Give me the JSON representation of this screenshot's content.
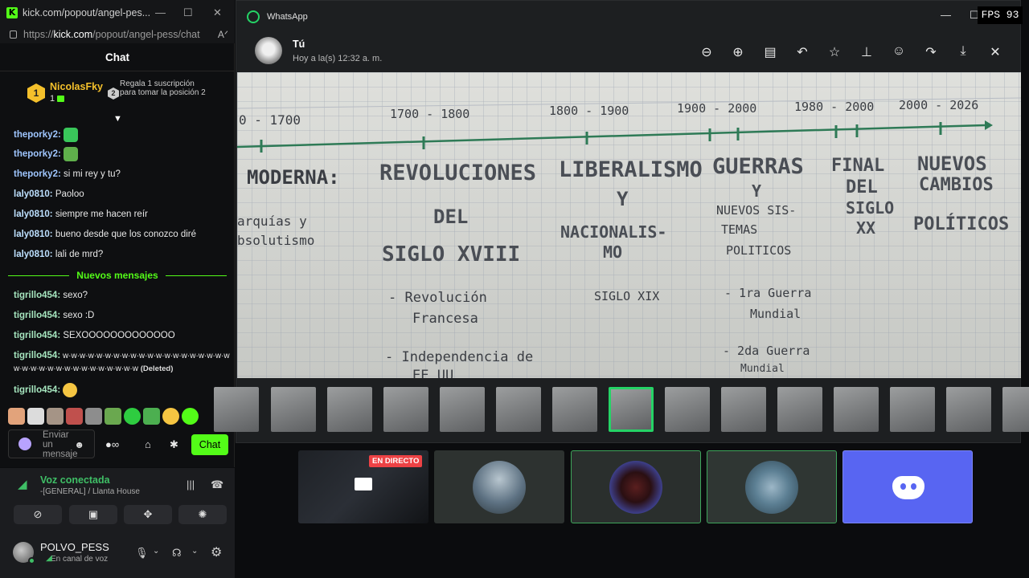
{
  "kick": {
    "tab_title": "kick.com/popout/angel-pes...",
    "url_prefix": "https://",
    "url_domain": "kick.com",
    "url_path": "/popout/angel-pess/chat",
    "chat_title": "Chat",
    "pinned": {
      "rank1_number": "1",
      "rank1_user": "NicolasFky",
      "rank1_count": "1",
      "rank2_number": "2",
      "rank2_text": "Regala 1 suscripción para tomar la posición 2"
    },
    "messages": [
      {
        "user": "theporky2",
        "text": ""
      },
      {
        "user": "theporky2",
        "text": ""
      },
      {
        "user": "theporky2",
        "text": "si mi rey y tu?"
      },
      {
        "user": "laly0810",
        "text": "Paoloo"
      },
      {
        "user": "laly0810",
        "text": "siempre me hacen reír"
      },
      {
        "user": "laly0810",
        "text": "bueno desde que los conozco diré"
      },
      {
        "user": "laly0810",
        "text": "lali de mrd?"
      }
    ],
    "new_messages_label": "Nuevos mensajes",
    "new_messages": [
      {
        "user": "tigrillo454",
        "text": "sexo?"
      },
      {
        "user": "tigrillo454",
        "text": "sexo :D"
      },
      {
        "user": "tigrillo454",
        "text": "SEXOOOOOOOOOOOOO"
      },
      {
        "user": "tigrillo454",
        "text": "w·w·w·w·w·w·w·w·w·w·w·w·w·w·w·w·w·w·w·w",
        "text2": "w·w·w·w·w·w·w·w·w·w·w·w·w·w·w",
        "deleted": "(Deleted)"
      },
      {
        "user": "tigrillo454",
        "text": ""
      }
    ],
    "input_placeholder": "Enviar un mensaje",
    "send_label": "Chat"
  },
  "discord": {
    "voice_title": "Voz conectada",
    "voice_channel": "-[GENERAL] / Llanta House",
    "username": "POLVO_PESS",
    "user_status": "En canal de voz"
  },
  "whatsapp": {
    "app_title": "WhatsApp",
    "sender": "Tú",
    "timestamp": "Hoy a la(s) 12:32 a. m.",
    "notebook": {
      "dates": [
        "0 - 1700",
        "1700 - 1800",
        "1800 - 1900",
        "1900 - 2000",
        "1980 - 2000",
        "2000 - 2026"
      ],
      "col1": [
        "MODERNA:",
        "arquías y",
        "bsolutismo"
      ],
      "col2": [
        "REVOLUCIONES",
        "DEL",
        "SIGLO XVIII",
        "- Revolución",
        "Francesa",
        "- Independencia de",
        "EE UU"
      ],
      "col3": [
        "LIBERALISMO",
        "Y",
        "NACIONALIS-",
        "MO",
        "SIGLO XIX"
      ],
      "col4": [
        "GUERRAS",
        "Y",
        "NUEVOS SIS-",
        "TEMAS",
        "POLITICOS",
        "- 1ra Guerra",
        "Mundial",
        "- 2da Guerra",
        "Mundial"
      ],
      "col5": [
        "FINAL",
        "DEL",
        "SIGLO",
        "XX"
      ],
      "col6": [
        "NUEVOS",
        "CAMBIOS",
        "POLÍTICOS"
      ]
    }
  },
  "overlay": {
    "fps": "FPS 93",
    "live_badge": "EN DIRECTO"
  },
  "colors": {
    "kick_green": "#53fc18",
    "whatsapp_green": "#25d366",
    "discord_blurple": "#5865f2",
    "voice_green": "#3fbf66",
    "live_red": "#ed4245"
  }
}
